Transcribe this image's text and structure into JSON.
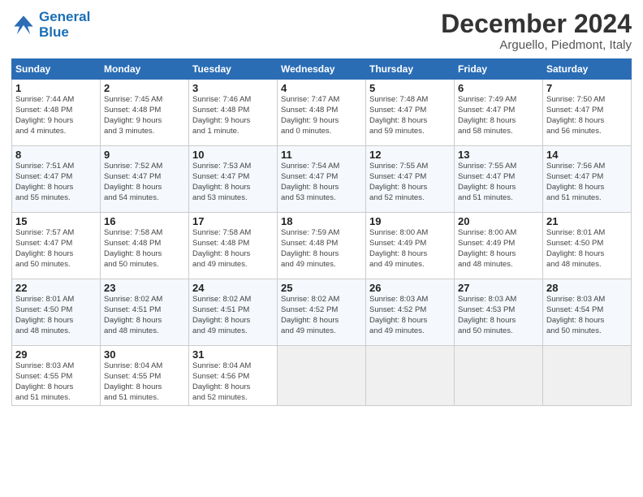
{
  "header": {
    "logo_line1": "General",
    "logo_line2": "Blue",
    "month": "December 2024",
    "location": "Arguello, Piedmont, Italy"
  },
  "weekdays": [
    "Sunday",
    "Monday",
    "Tuesday",
    "Wednesday",
    "Thursday",
    "Friday",
    "Saturday"
  ],
  "weeks": [
    [
      {
        "day": "1",
        "info": "Sunrise: 7:44 AM\nSunset: 4:48 PM\nDaylight: 9 hours\nand 4 minutes."
      },
      {
        "day": "2",
        "info": "Sunrise: 7:45 AM\nSunset: 4:48 PM\nDaylight: 9 hours\nand 3 minutes."
      },
      {
        "day": "3",
        "info": "Sunrise: 7:46 AM\nSunset: 4:48 PM\nDaylight: 9 hours\nand 1 minute."
      },
      {
        "day": "4",
        "info": "Sunrise: 7:47 AM\nSunset: 4:48 PM\nDaylight: 9 hours\nand 0 minutes."
      },
      {
        "day": "5",
        "info": "Sunrise: 7:48 AM\nSunset: 4:47 PM\nDaylight: 8 hours\nand 59 minutes."
      },
      {
        "day": "6",
        "info": "Sunrise: 7:49 AM\nSunset: 4:47 PM\nDaylight: 8 hours\nand 58 minutes."
      },
      {
        "day": "7",
        "info": "Sunrise: 7:50 AM\nSunset: 4:47 PM\nDaylight: 8 hours\nand 56 minutes."
      }
    ],
    [
      {
        "day": "8",
        "info": "Sunrise: 7:51 AM\nSunset: 4:47 PM\nDaylight: 8 hours\nand 55 minutes."
      },
      {
        "day": "9",
        "info": "Sunrise: 7:52 AM\nSunset: 4:47 PM\nDaylight: 8 hours\nand 54 minutes."
      },
      {
        "day": "10",
        "info": "Sunrise: 7:53 AM\nSunset: 4:47 PM\nDaylight: 8 hours\nand 53 minutes."
      },
      {
        "day": "11",
        "info": "Sunrise: 7:54 AM\nSunset: 4:47 PM\nDaylight: 8 hours\nand 53 minutes."
      },
      {
        "day": "12",
        "info": "Sunrise: 7:55 AM\nSunset: 4:47 PM\nDaylight: 8 hours\nand 52 minutes."
      },
      {
        "day": "13",
        "info": "Sunrise: 7:55 AM\nSunset: 4:47 PM\nDaylight: 8 hours\nand 51 minutes."
      },
      {
        "day": "14",
        "info": "Sunrise: 7:56 AM\nSunset: 4:47 PM\nDaylight: 8 hours\nand 51 minutes."
      }
    ],
    [
      {
        "day": "15",
        "info": "Sunrise: 7:57 AM\nSunset: 4:47 PM\nDaylight: 8 hours\nand 50 minutes."
      },
      {
        "day": "16",
        "info": "Sunrise: 7:58 AM\nSunset: 4:48 PM\nDaylight: 8 hours\nand 50 minutes."
      },
      {
        "day": "17",
        "info": "Sunrise: 7:58 AM\nSunset: 4:48 PM\nDaylight: 8 hours\nand 49 minutes."
      },
      {
        "day": "18",
        "info": "Sunrise: 7:59 AM\nSunset: 4:48 PM\nDaylight: 8 hours\nand 49 minutes."
      },
      {
        "day": "19",
        "info": "Sunrise: 8:00 AM\nSunset: 4:49 PM\nDaylight: 8 hours\nand 49 minutes."
      },
      {
        "day": "20",
        "info": "Sunrise: 8:00 AM\nSunset: 4:49 PM\nDaylight: 8 hours\nand 48 minutes."
      },
      {
        "day": "21",
        "info": "Sunrise: 8:01 AM\nSunset: 4:50 PM\nDaylight: 8 hours\nand 48 minutes."
      }
    ],
    [
      {
        "day": "22",
        "info": "Sunrise: 8:01 AM\nSunset: 4:50 PM\nDaylight: 8 hours\nand 48 minutes."
      },
      {
        "day": "23",
        "info": "Sunrise: 8:02 AM\nSunset: 4:51 PM\nDaylight: 8 hours\nand 48 minutes."
      },
      {
        "day": "24",
        "info": "Sunrise: 8:02 AM\nSunset: 4:51 PM\nDaylight: 8 hours\nand 49 minutes."
      },
      {
        "day": "25",
        "info": "Sunrise: 8:02 AM\nSunset: 4:52 PM\nDaylight: 8 hours\nand 49 minutes."
      },
      {
        "day": "26",
        "info": "Sunrise: 8:03 AM\nSunset: 4:52 PM\nDaylight: 8 hours\nand 49 minutes."
      },
      {
        "day": "27",
        "info": "Sunrise: 8:03 AM\nSunset: 4:53 PM\nDaylight: 8 hours\nand 50 minutes."
      },
      {
        "day": "28",
        "info": "Sunrise: 8:03 AM\nSunset: 4:54 PM\nDaylight: 8 hours\nand 50 minutes."
      }
    ],
    [
      {
        "day": "29",
        "info": "Sunrise: 8:03 AM\nSunset: 4:55 PM\nDaylight: 8 hours\nand 51 minutes."
      },
      {
        "day": "30",
        "info": "Sunrise: 8:04 AM\nSunset: 4:55 PM\nDaylight: 8 hours\nand 51 minutes."
      },
      {
        "day": "31",
        "info": "Sunrise: 8:04 AM\nSunset: 4:56 PM\nDaylight: 8 hours\nand 52 minutes."
      },
      null,
      null,
      null,
      null
    ]
  ]
}
